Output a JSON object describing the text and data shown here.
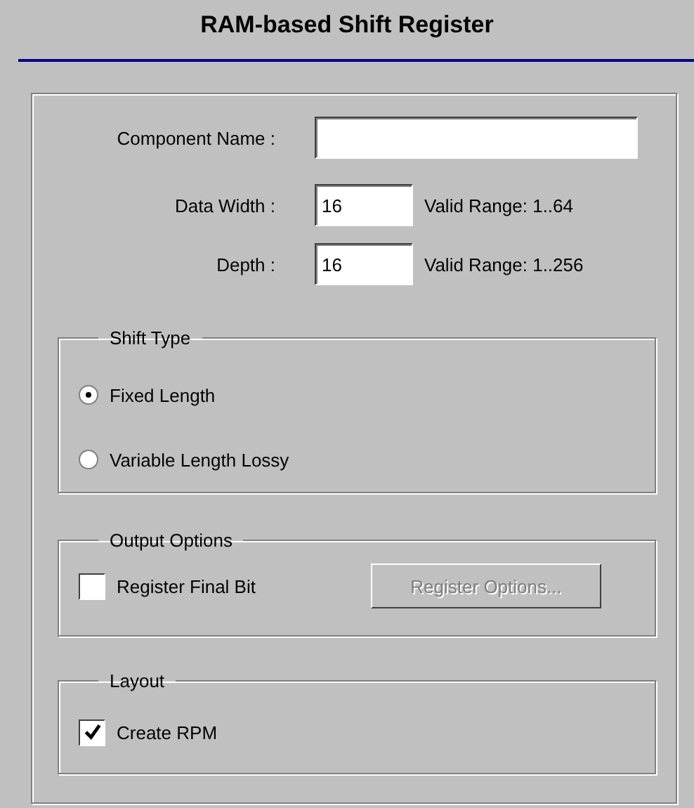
{
  "title": "RAM-based Shift Register",
  "component_name": {
    "label": "Component Name :"
  },
  "numeric_fields": [
    {
      "label": "Data Width :",
      "value": "16",
      "hint": "Valid Range: 1..64"
    },
    {
      "label": "Depth :",
      "value": "16",
      "hint": "Valid Range: 1..256"
    }
  ],
  "shift_type": {
    "title": "Shift Type",
    "options": [
      {
        "label": "Fixed Length",
        "selected": true
      },
      {
        "label": "Variable Length Lossy",
        "selected": false
      }
    ]
  },
  "output_options": {
    "title": "Output Options",
    "register_final_bit": {
      "label": "Register Final Bit",
      "checked": false
    },
    "register_options_button": {
      "label": "Register Options...",
      "disabled": true
    }
  },
  "layout": {
    "title": "Layout",
    "create_rpm": {
      "label": "Create RPM",
      "checked": true
    }
  }
}
